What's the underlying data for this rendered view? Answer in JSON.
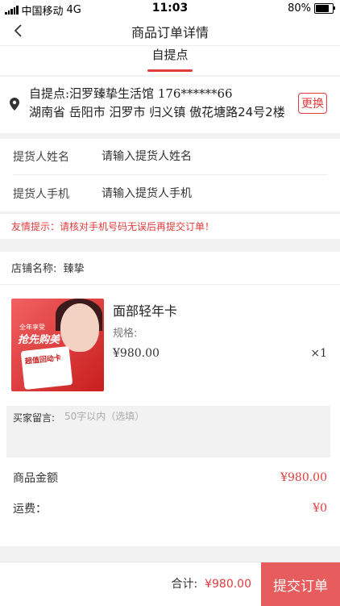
{
  "status_bar": {
    "carrier": "中国移动",
    "network": "4G",
    "time": "11:03",
    "battery": "80%",
    "battery_level": 0.8
  },
  "nav": {
    "title": "商品订单详情"
  },
  "tab": {
    "label": "自提点"
  },
  "address": {
    "line1": "自提点:汨罗臻挚生活馆 176******66",
    "line2": "湖南省 岳阳市 汨罗市 归义镇 傲花塘路24号2楼",
    "change_label": "更换"
  },
  "pickup": {
    "name_label": "提货人姓名",
    "name_placeholder": "请输入提货人姓名",
    "phone_label": "提货人手机",
    "phone_placeholder": "请输入提货人手机"
  },
  "tip": "友情提示：请核对手机号码无误后再提交订单！",
  "shop": {
    "name_label": "店铺名称:",
    "name": "臻挚"
  },
  "product": {
    "name": "面部轻年卡",
    "spec_label": "规格:",
    "price": "¥980.00",
    "qty": "×1",
    "image_text1": "全年享受",
    "image_text2": "抢先购美",
    "image_text3": "超值回动卡"
  },
  "remark": {
    "label": "买家留言:",
    "placeholder": "50字以内（选填）"
  },
  "summary": {
    "amount_label": "商品金额",
    "amount": "¥980.00",
    "freight_label": "运费：",
    "freight": "¥0"
  },
  "footer": {
    "total_label": "合计:",
    "total": "¥980.00",
    "submit_label": "提交订单"
  },
  "colors": {
    "accent": "#e03c3c",
    "submit_bg": "#e75c5c"
  }
}
